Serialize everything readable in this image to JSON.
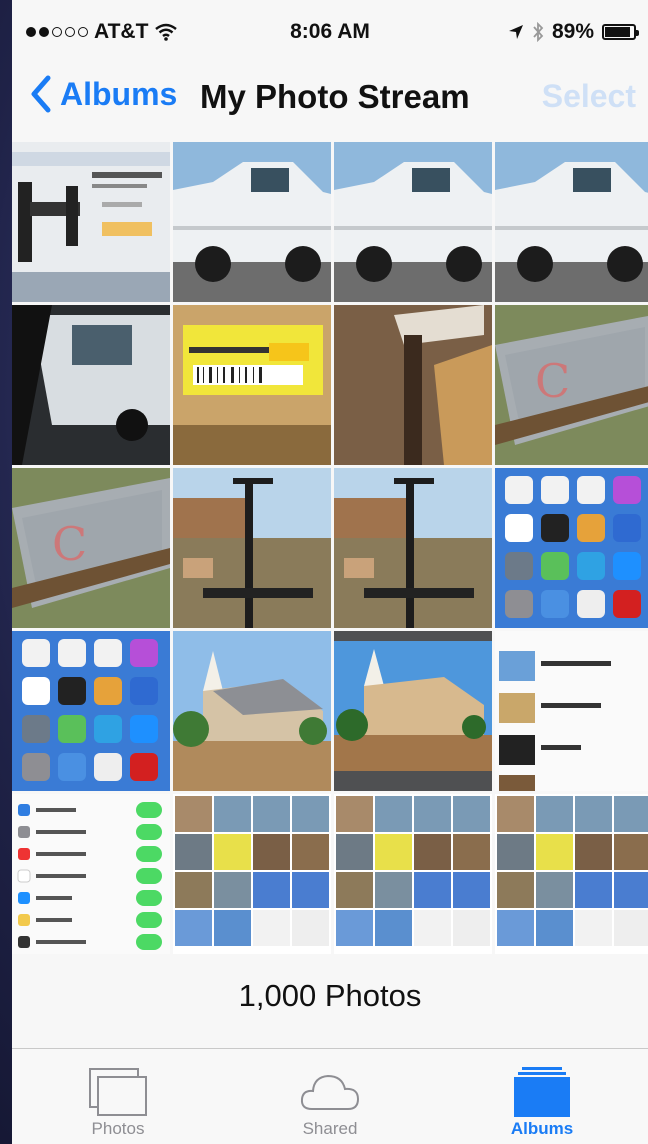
{
  "status_bar": {
    "carrier": "AT&T",
    "time": "8:06 AM",
    "battery": "89%",
    "battery_level": 0.89,
    "signal_bars_filled": 2,
    "signal_bars_total": 5,
    "icons": [
      "wifi-icon",
      "location-arrow-icon",
      "bluetooth-icon",
      "battery-icon"
    ]
  },
  "nav": {
    "back_label": "Albums",
    "title": "My Photo Stream",
    "select_label": "Select",
    "accent_color": "#1a7cf5",
    "disabled_color": "#cfe0f6"
  },
  "photos": [
    {
      "subject": "tv-mount-webpage"
    },
    {
      "subject": "white-pickup-truck"
    },
    {
      "subject": "white-pickup-truck"
    },
    {
      "subject": "white-pickup-truck"
    },
    {
      "subject": "truck-from-car"
    },
    {
      "subject": "price-tag"
    },
    {
      "subject": "wooden-frame"
    },
    {
      "subject": "glass-sign-on-grass"
    },
    {
      "subject": "glass-sign-on-grass"
    },
    {
      "subject": "garage-sale-exercise-bench"
    },
    {
      "subject": "garage-sale-exercise-bench"
    },
    {
      "subject": "ios-home-screen"
    },
    {
      "subject": "ios-home-screen"
    },
    {
      "subject": "church"
    },
    {
      "subject": "church-edited"
    },
    {
      "subject": "albums-list-screenshot"
    },
    {
      "subject": "settings-screenshot"
    },
    {
      "subject": "photo-grid-screenshot"
    },
    {
      "subject": "photo-grid-screenshot"
    },
    {
      "subject": "photo-grid-screenshot"
    }
  ],
  "photo_count_label": "1,000 Photos",
  "tabs": [
    {
      "label": "Photos",
      "icon": "photos-icon",
      "active": false
    },
    {
      "label": "Shared",
      "icon": "cloud-icon",
      "active": false
    },
    {
      "label": "Albums",
      "icon": "albums-icon",
      "active": true
    }
  ]
}
